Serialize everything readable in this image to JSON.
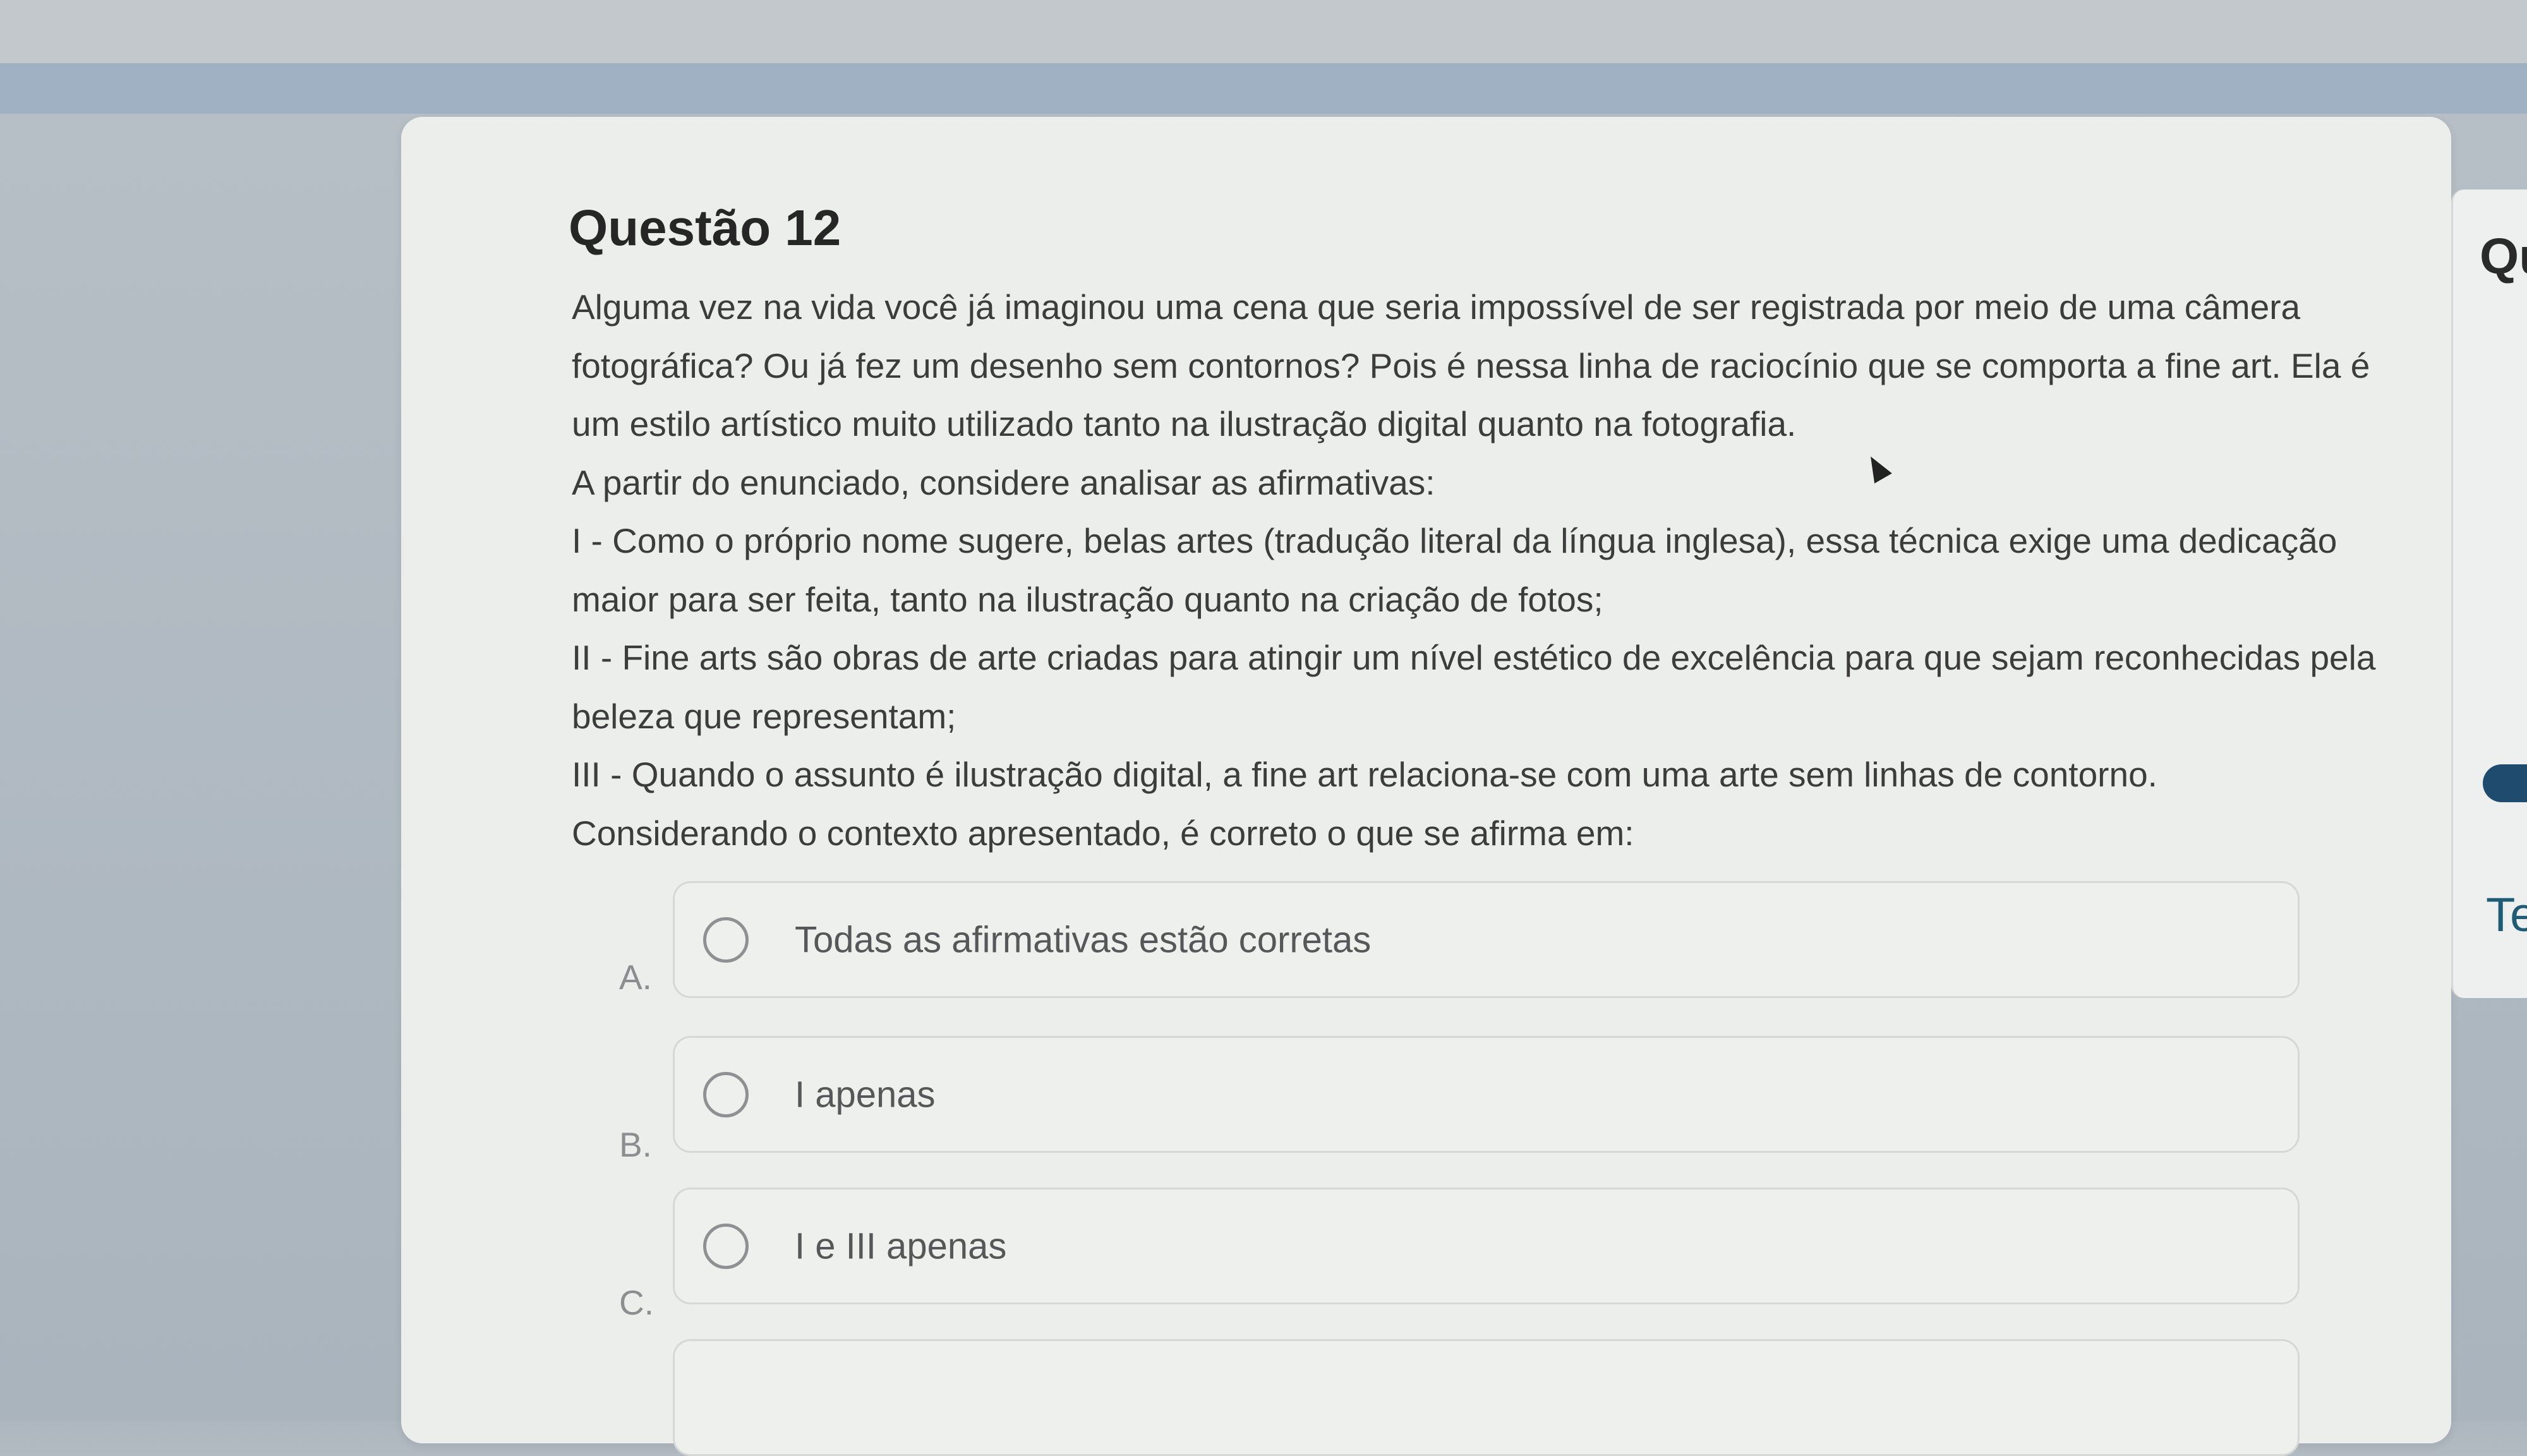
{
  "question": {
    "title": "Questão 12",
    "paragraphs": [
      "Alguma vez na vida você já imaginou uma cena que seria impossível de ser registrada por meio de uma câmera fotográfica? Ou já fez um desenho sem contornos? Pois é nessa linha de raciocínio que se comporta a fine art. Ela é um estilo artístico muito utilizado tanto na ilustração digital quanto na fotografia.",
      "A partir do enunciado, considere analisar as afirmativas:",
      "I - Como o próprio nome sugere, belas artes (tradução literal da língua inglesa), essa técnica exige uma dedicação maior para ser feita, tanto na ilustração quanto na criação de fotos;",
      "II - Fine arts são obras de arte criadas para atingir um nível estético de excelência para que sejam reconhecidas pela beleza que representam;",
      "III - Quando o assunto é ilustração digital, a fine art relaciona-se com uma arte sem linhas de contorno.",
      "Considerando o contexto apresentado, é correto o que se afirma em:"
    ]
  },
  "options": [
    {
      "letter": "A.",
      "text": "Todas as afirmativas estão corretas"
    },
    {
      "letter": "B.",
      "text": "I apenas"
    },
    {
      "letter": "C.",
      "text": "I e III apenas"
    }
  ],
  "right_panel": {
    "title": "Qu",
    "text": "Te"
  }
}
